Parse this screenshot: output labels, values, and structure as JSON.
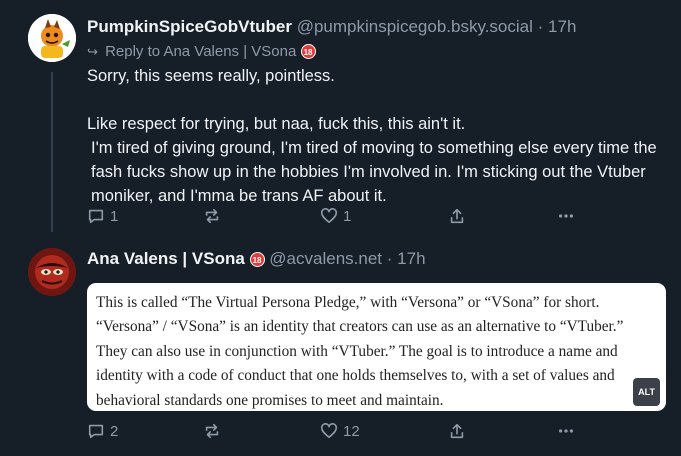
{
  "post1": {
    "display_name": "PumpkinSpiceGobVtuber",
    "handle": "@pumpkinspicegob.bsky.social",
    "time": "17h",
    "reply_prefix": "Reply to",
    "reply_to": "Ana Valens | VSona",
    "reply_badge": "18",
    "paragraphs": [
      "Sorry, this seems really, pointless.",
      "Like respect for trying, but naa, fuck this, this ain't it.",
      "I'm tired of giving ground, I'm tired of moving to something else every time the fash fucks show up in the hobbies I'm involved in. I'm sticking out the Vtuber moniker, and I'mma be trans AF about it."
    ],
    "actions": {
      "replies": "1",
      "reposts": "",
      "likes": "1"
    }
  },
  "post2": {
    "display_name": "Ana Valens | VSona",
    "badge": "18",
    "handle": "@acvalens.net",
    "time": "17h",
    "image_text": "This is called “The Virtual Persona Pledge,” with “Versona” or “VSona” for short. “Versona” / “VSona” is an identity that creators can use as an alternative to “VTuber.” They can also use in conjunction with “VTuber.” The goal is to introduce a name and identity with a code of conduct that one holds themselves to, with a set of values and behavioral standards one promises to meet and maintain.",
    "alt_label": "ALT",
    "actions": {
      "replies": "2",
      "reposts": "",
      "likes": "12"
    }
  },
  "icons": {
    "reply": "reply-arrow-icon",
    "comment": "speech-bubble-icon",
    "repost": "repost-arrows-icon",
    "like": "heart-icon",
    "share": "share-upload-icon",
    "more": "more-dots-icon"
  },
  "colors": {
    "background": "#161e27",
    "muted": "#8d9aa8",
    "thread_line": "#2e4052"
  }
}
